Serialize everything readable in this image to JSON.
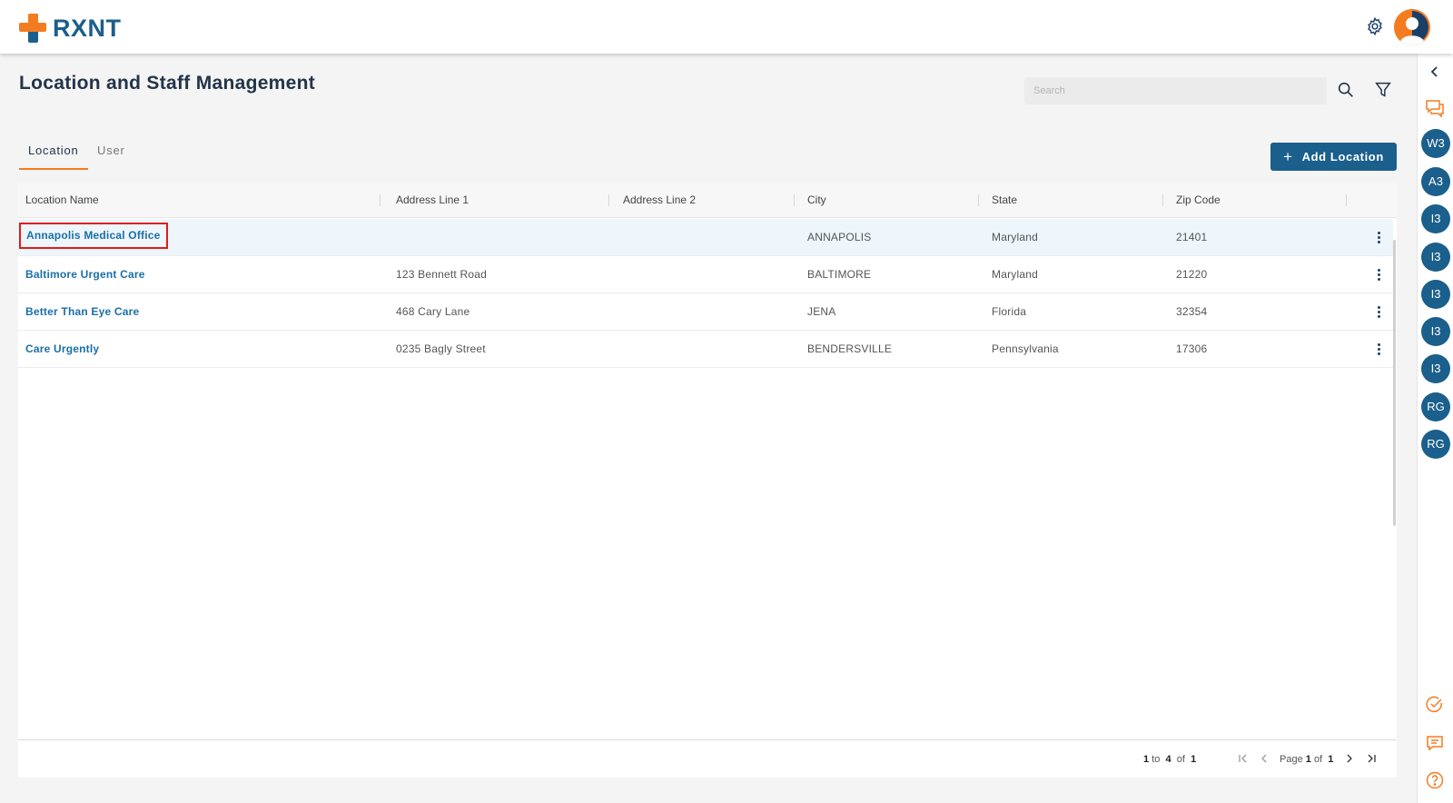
{
  "brand": {
    "name": "RXNT"
  },
  "page": {
    "title": "Location and Staff Management"
  },
  "search": {
    "placeholder": "Search"
  },
  "tabs": [
    {
      "label": "Location",
      "active": true
    },
    {
      "label": "User",
      "active": false
    }
  ],
  "actions": {
    "add_location_label": "Add Location"
  },
  "table": {
    "columns": [
      "Location Name",
      "Address Line 1",
      "Address Line 2",
      "City",
      "State",
      "Zip Code"
    ],
    "rows": [
      {
        "name": "Annapolis Medical Office",
        "address1": "",
        "address2": "",
        "city": "ANNAPOLIS",
        "state": "Maryland",
        "zip": "21401"
      },
      {
        "name": "Baltimore Urgent Care",
        "address1": "123 Bennett Road",
        "address2": "",
        "city": "BALTIMORE",
        "state": "Maryland",
        "zip": "21220"
      },
      {
        "name": "Better Than Eye Care",
        "address1": "468 Cary Lane",
        "address2": "",
        "city": "JENA",
        "state": "Florida",
        "zip": "32354"
      },
      {
        "name": "Care Urgently",
        "address1": "0235 Bagly Street",
        "address2": "",
        "city": "BENDERSVILLE",
        "state": "Pennsylvania",
        "zip": "17306"
      }
    ]
  },
  "pagination": {
    "from": "1",
    "to_label": "to",
    "to": "4",
    "of_label": "of",
    "total": "1",
    "page_label": "Page",
    "page": "1",
    "page_of_label": "of",
    "pages": "1"
  },
  "rail": {
    "badges": [
      "W3",
      "A3",
      "I3",
      "I3",
      "I3",
      "I3",
      "I3",
      "RG",
      "RG"
    ]
  },
  "colors": {
    "brand_blue": "#1b5f8c",
    "brand_orange": "#f47c20",
    "link_blue": "#1b6fa8",
    "highlight_red": "#e31a1a"
  }
}
